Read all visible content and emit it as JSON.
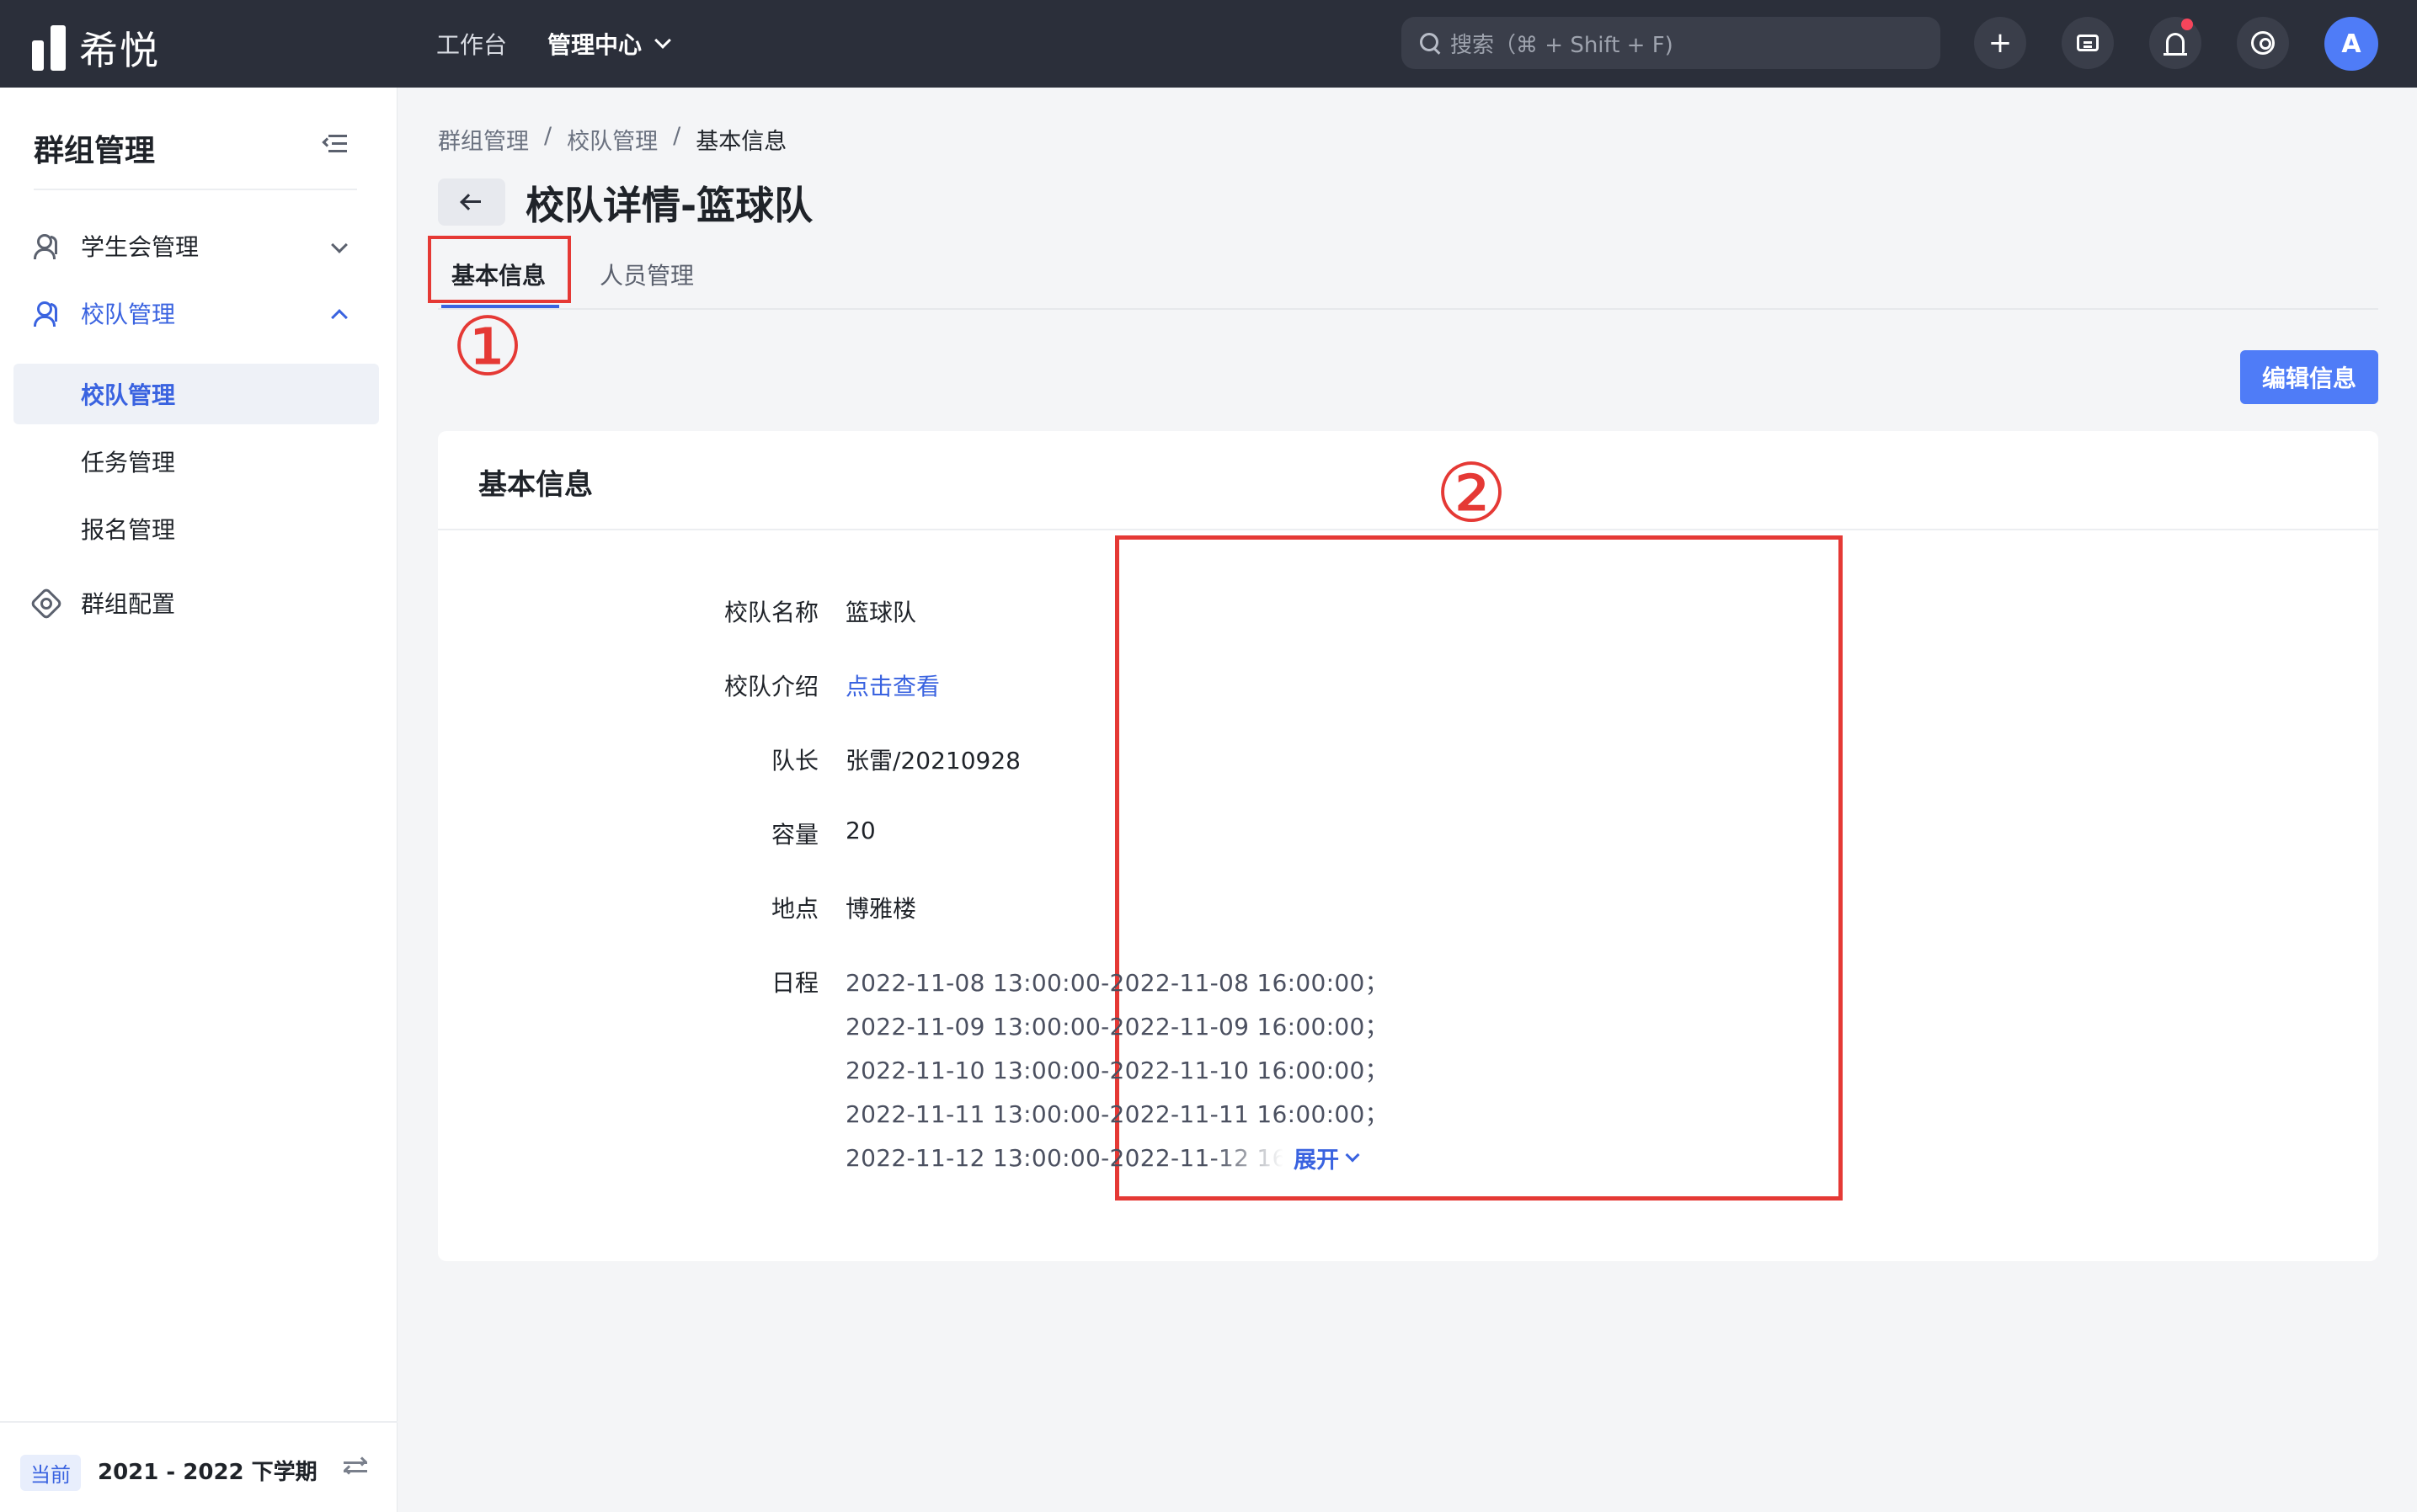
{
  "app": {
    "logo_text": "希悦"
  },
  "topnav": {
    "items": [
      {
        "label": "工作台"
      },
      {
        "label": "管理中心"
      }
    ]
  },
  "search": {
    "placeholder": "搜索（⌘ + Shift + F)"
  },
  "topbar": {
    "plus_glyph": "+",
    "avatar_letter": "A",
    "notification_dot_color": "#f5455b"
  },
  "sidebar": {
    "title": "群组管理",
    "menu": [
      {
        "label": "学生会管理",
        "icon": "users-icon"
      },
      {
        "label": "校队管理",
        "icon": "users-icon",
        "expanded": true
      },
      {
        "label": "群组配置",
        "icon": "gear-icon"
      }
    ],
    "submenu": [
      {
        "label": "校队管理"
      },
      {
        "label": "任务管理"
      },
      {
        "label": "报名管理"
      }
    ],
    "footer": {
      "badge": "当前",
      "term": "2021 - 2022 下学期"
    }
  },
  "breadcrumb": [
    "群组管理",
    "校队管理",
    "基本信息"
  ],
  "breadcrumb_sep": "/",
  "page": {
    "title": "校队详情-篮球队"
  },
  "tabs": [
    {
      "label": "基本信息"
    },
    {
      "label": "人员管理"
    }
  ],
  "annotations": {
    "marker_1": "①",
    "marker_2": "②",
    "color": "#e53935"
  },
  "edit_button": "编辑信息",
  "card": {
    "title": "基本信息",
    "fields": [
      {
        "label": "校队名称",
        "value": "篮球队"
      },
      {
        "label": "校队介绍",
        "value": "点击查看"
      },
      {
        "label": "队长",
        "value": "张雷/20210928"
      },
      {
        "label": "容量",
        "value": "20"
      },
      {
        "label": "地点",
        "value": "博雅楼"
      },
      {
        "label": "日程",
        "value": ""
      }
    ],
    "schedule": [
      "2022-11-08 13:00:00-2022-11-08 16:00:00；",
      "2022-11-09 13:00:00-2022-11-09 16:00:00；",
      "2022-11-10 13:00:00-2022-11-10 16:00:00；",
      "2022-11-11 13:00:00-2022-11-11 16:00:00；",
      "2022-11-12 13:00:00-2022-11-12 16:00:00；"
    ],
    "expand_label": "展开"
  },
  "colors": {
    "accent": "#3a63e0",
    "button": "#4f7cf7",
    "topbar": "#2b2f3a"
  }
}
